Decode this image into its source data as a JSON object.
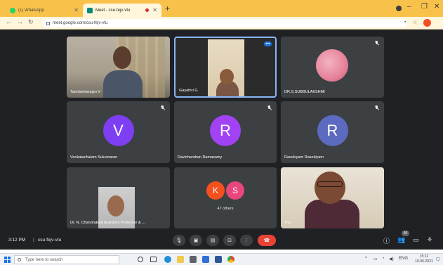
{
  "browser": {
    "tabs": [
      {
        "label": "(1) WhatsApp",
        "favicon_color": "#25d366",
        "active": false
      },
      {
        "label": "Meet - csu-fejv-vtu",
        "favicon_color": "#00897b",
        "active": true
      }
    ],
    "url": "meet.google.com/csu-fejv-vtu"
  },
  "meeting": {
    "participants": [
      {
        "name": "Tamilselvarajan V",
        "type": "video"
      },
      {
        "name": "Gayathri G",
        "type": "video",
        "pinned": true
      },
      {
        "name": "DR.S.SUBBULAKSHMI",
        "type": "video"
      },
      {
        "name": "Venkatachalam Sukumaran",
        "type": "avatar",
        "initial": "V",
        "color": "#7e3ff2"
      },
      {
        "name": "Ravichandran Ramasamy",
        "type": "avatar",
        "initial": "R",
        "color": "#a142f4"
      },
      {
        "name": "Rasokiyam Rasokiyam",
        "type": "avatar",
        "initial": "R",
        "color": "#5c6bc0"
      },
      {
        "name": "Dr. N. Chandrakala Assistant Professor & ...",
        "type": "video"
      },
      {
        "name": "You",
        "type": "video"
      }
    ],
    "others": {
      "label": "47 others",
      "circles": [
        {
          "initial": "K",
          "color": "#f4511e"
        },
        {
          "initial": "S",
          "color": "#e8467c"
        }
      ]
    },
    "time": "3:12 PM",
    "code": "csu-fejv-vtu",
    "participant_badge": "50"
  },
  "taskbar": {
    "search_placeholder": "Type here to search",
    "tray_lang": "ENG",
    "clock_time": "15:12",
    "clock_date": "10-06-2021"
  }
}
